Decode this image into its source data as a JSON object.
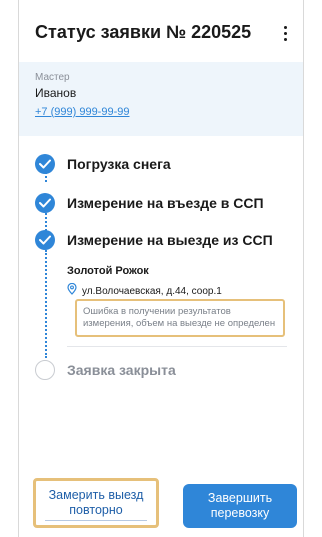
{
  "header": {
    "title": "Статус заявки № 220525",
    "menu_icon": "more-vertical-icon"
  },
  "master": {
    "label": "Мастер",
    "name": "Иванов",
    "phone": "+7 (999) 999-99-99"
  },
  "steps": [
    {
      "label": "Погрузка снега",
      "state": "done",
      "icon": "check-circle-icon"
    },
    {
      "label": "Измерение на въезде в ССП",
      "state": "done",
      "icon": "check-circle-icon"
    },
    {
      "label": "Измерение на выезде из ССП",
      "state": "done",
      "icon": "check-circle-icon"
    },
    {
      "label": "Заявка закрыта",
      "state": "pending",
      "icon": "empty-circle-icon"
    }
  ],
  "location": {
    "name": "Золотой Рожок",
    "address": "ул.Волочаевская, д.44, соор.1",
    "icon": "location-pin-icon"
  },
  "error": {
    "line1": "Ошибка в получении результатов",
    "line2": "измерения, объем на выезде не определен"
  },
  "actions": {
    "remeasure_line1": "Замерить выезд",
    "remeasure_line2": "повторно",
    "finish_line1": "Завершить",
    "finish_line2": "перевозку"
  },
  "colors": {
    "accent": "#2f86d8",
    "highlight": "#e6c07a",
    "panel": "#eef5fb"
  }
}
